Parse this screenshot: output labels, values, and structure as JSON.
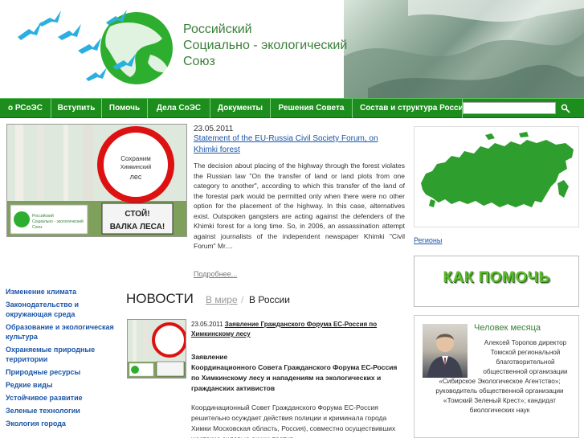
{
  "header": {
    "title_lines": [
      "Российский",
      "Социально - экологический",
      "Союз"
    ]
  },
  "nav": {
    "items": [
      "о РСоЭС",
      "Вступить",
      "Помочь",
      "Дела СоЭС",
      "Документы",
      "Решения Совета",
      "Состав и структура России"
    ],
    "search_placeholder": "",
    "search_icon": "magnifier-icon"
  },
  "feature": {
    "date": "23.05.2011",
    "title": "Statement of the EU-Russia Civil Society Forum, on Khimki forest",
    "text": "The decision about placing of the highway through the forest violates the Russian law \"On the transfer of land or land plots from one category to another\", according to which this transfer of the land of the forestal park would be permitted only when there were no other option for the placement of the highway. In this case, alternatives exist. Outspoken gangsters are acting against the defenders of the Khimki forest for a long time. So, in 2006, an assassination attempt against journalists of the independent newspaper Khimki \"Civil Forum\" Mr....",
    "more": "Подробнее...",
    "sign_top": "Сохраним Химкинский лес",
    "sign_bottom": "СТОЙ! ВАЛКА ЛЕСА!",
    "mini_logo": "Российский Социально - экологический Союз"
  },
  "categories": [
    "Изменение климата",
    "Законодательство и окружающая среда",
    "Образование и экологическая культура",
    "Охраняемые природные территории",
    "Природные ресурсы",
    "Редкие виды",
    "Устойчивое развитие",
    "Зеленые технологии",
    "Экология города"
  ],
  "news": {
    "title": "НОВОСТИ",
    "tab_world": "В мире",
    "separator": "/",
    "tab_russia": "В России",
    "date": "23.05.2011",
    "link": "Заявление Гражданского Форума ЕС-Россия по Химкинскому лесу",
    "heading_line1": "Заявление",
    "heading": "Координационного Совета Гражданского Форума ЕС-Россия по Химкинскому лесу и нападениям на экологических и гражданских активистов",
    "body": "Координационный Совет Гражданского Форума ЕС-Россия решительно осуждает действия полиции и криминала города Химки Московская область, Россия), совместно осуществивших жестокие силовые акции против"
  },
  "sidebar_right": {
    "regions": "Регионы",
    "help": "КАК ПОМОЧЬ",
    "person_title": "Человек месяца",
    "person_text_indented": "Алексей Торопов директор Томской региональной благотворительной общественной организации",
    "person_text": "«Сибирское Экологическое Агентство»; руководитель общественной организации «Томский Зеленый Крест»; кандидат биологических наук"
  },
  "colors": {
    "nav_green": "#1d8d1d",
    "title_green": "#3a7f3a",
    "link_blue": "#1a55a8",
    "map_green": "#2e9e2e",
    "help_green": "#5cbf2a"
  }
}
